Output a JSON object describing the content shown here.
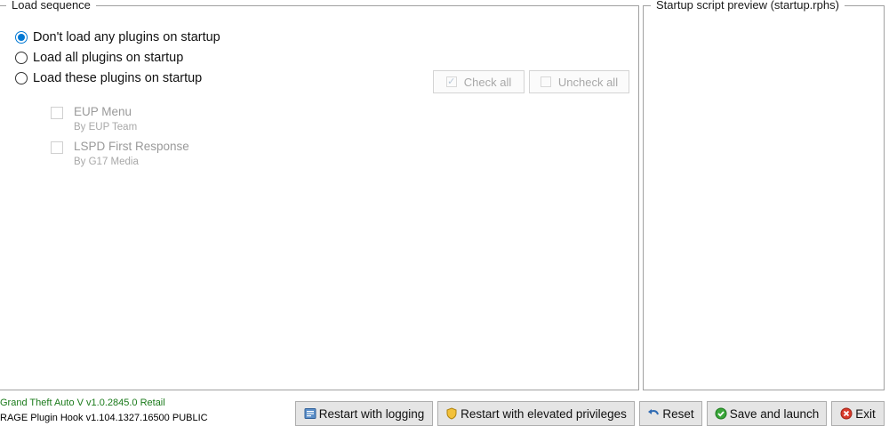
{
  "load_sequence": {
    "title": "Load sequence",
    "options": [
      {
        "label": "Don't load any plugins on startup",
        "selected": true
      },
      {
        "label": "Load all plugins on startup",
        "selected": false
      },
      {
        "label": "Load these plugins on startup",
        "selected": false
      }
    ],
    "check_all_label": "Check all",
    "uncheck_all_label": "Uncheck all",
    "plugins": [
      {
        "name": "EUP Menu",
        "author": "By EUP Team"
      },
      {
        "name": "LSPD First Response",
        "author": "By G17 Media"
      }
    ]
  },
  "preview": {
    "title": "Startup script preview (startup.rphs)"
  },
  "status": {
    "game_version": "Grand Theft Auto V v1.0.2845.0 Retail",
    "rph_version": "RAGE Plugin Hook v1.104.1327.16500 PUBLIC"
  },
  "buttons": {
    "restart_logging": "Restart with logging",
    "restart_elevated": "Restart with elevated privileges",
    "reset": "Reset",
    "save_launch": "Save and launch",
    "exit": "Exit"
  },
  "colors": {
    "accent": "#0078d4",
    "game_version_text": "#1a7a1a"
  }
}
